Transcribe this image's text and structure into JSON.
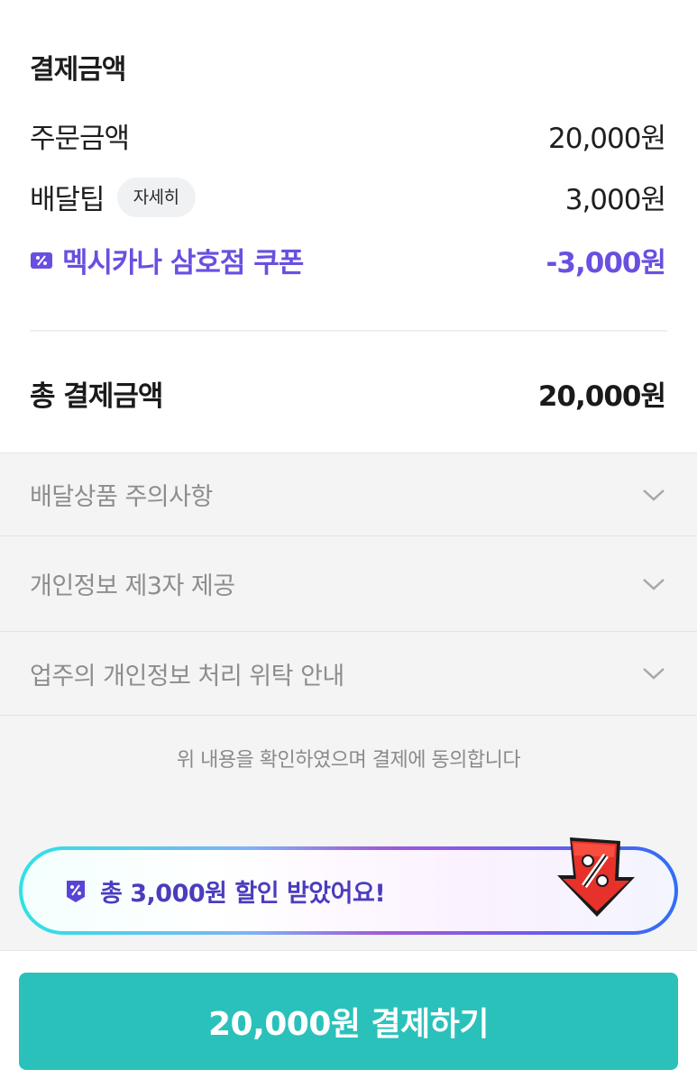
{
  "summary": {
    "title": "결제금액",
    "order": {
      "label": "주문금액",
      "value": "20,000원"
    },
    "delivery_tip": {
      "label": "배달팁",
      "detail_chip": "자세히",
      "value": "3,000원"
    },
    "coupon": {
      "label": "멕시카나 삼호점 쿠폰",
      "value": "-3,000원",
      "color": "#6a4fe0",
      "icon": "coupon-icon"
    },
    "total": {
      "label": "총 결제금액",
      "value": "20,000원"
    }
  },
  "accordion": [
    {
      "label": "배달상품 주의사항",
      "icon": "chevron-down-icon"
    },
    {
      "label": "개인정보 제3자 제공",
      "icon": "chevron-down-icon"
    },
    {
      "label": "업주의 개인정보 처리 위탁 안내",
      "icon": "chevron-down-icon"
    }
  ],
  "agreement_text": "위 내용을 확인하였으며 결제에 동의합니다",
  "discount_banner": {
    "text": "총 3,000원 할인 받았어요!",
    "icon": "discount-tag-icon",
    "badge_icon": "percent-arrow-badge-icon"
  },
  "pay_button": {
    "label": "20,000원 결제하기",
    "color": "#2bc1bb"
  }
}
